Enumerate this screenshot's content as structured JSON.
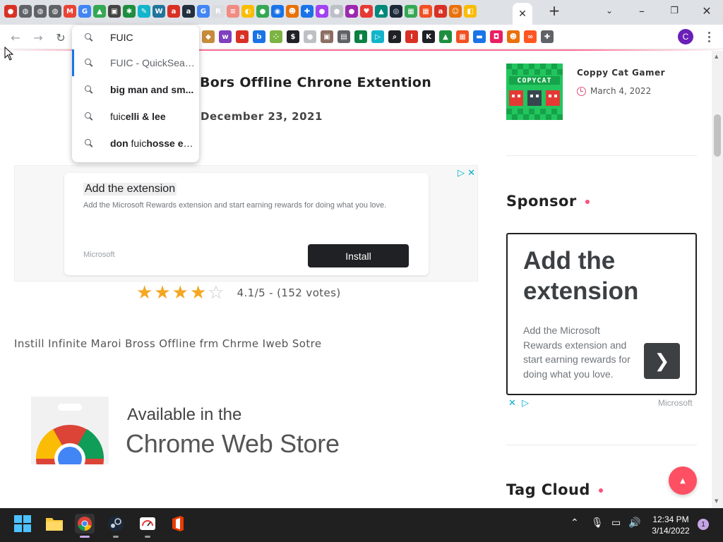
{
  "browser": {
    "tab_favicons": [
      {
        "name": "tab-favicon-red",
        "color": "#d93025",
        "glyph": "●"
      },
      {
        "name": "tab-favicon-globe",
        "color": "#5f6368",
        "glyph": "◍"
      },
      {
        "name": "tab-favicon-globe",
        "color": "#5f6368",
        "glyph": "◍"
      },
      {
        "name": "tab-favicon-globe",
        "color": "#5f6368",
        "glyph": "◍"
      },
      {
        "name": "tab-favicon-gmail",
        "color": "#ea4335",
        "glyph": "M"
      },
      {
        "name": "tab-favicon-google",
        "color": "#4285f4",
        "glyph": "G"
      },
      {
        "name": "tab-favicon-drive",
        "color": "#34a853",
        "glyph": "▲"
      },
      {
        "name": "tab-favicon-app",
        "color": "#444444",
        "glyph": "▣"
      },
      {
        "name": "tab-favicon-app",
        "color": "#1e8e3e",
        "glyph": "✱"
      },
      {
        "name": "tab-favicon-app",
        "color": "#12b5cb",
        "glyph": "✎"
      },
      {
        "name": "tab-favicon-wordpress",
        "color": "#21759b",
        "glyph": "W"
      },
      {
        "name": "tab-favicon-ask",
        "color": "#d93025",
        "glyph": "a"
      },
      {
        "name": "tab-favicon-amazon",
        "color": "#232f3e",
        "glyph": "a"
      },
      {
        "name": "tab-favicon-google",
        "color": "#4285f4",
        "glyph": "G"
      },
      {
        "name": "tab-favicon-app",
        "color": "#dadce0",
        "glyph": "R"
      },
      {
        "name": "tab-favicon-app",
        "color": "#f28b82",
        "glyph": "≡"
      },
      {
        "name": "tab-favicon-app",
        "color": "#fbbc04",
        "glyph": "◐"
      },
      {
        "name": "tab-favicon-app",
        "color": "#34a853",
        "glyph": "●"
      },
      {
        "name": "tab-favicon-app",
        "color": "#1a73e8",
        "glyph": "◉"
      },
      {
        "name": "tab-favicon-app",
        "color": "#e8710a",
        "glyph": "☻"
      },
      {
        "name": "tab-favicon-app",
        "color": "#1a73e8",
        "glyph": "✚"
      },
      {
        "name": "tab-favicon-app",
        "color": "#a142f4",
        "glyph": "●"
      },
      {
        "name": "tab-favicon-app",
        "color": "#bdc1c6",
        "glyph": "●"
      },
      {
        "name": "tab-favicon-app",
        "color": "#9c27b0",
        "glyph": "●"
      },
      {
        "name": "tab-favicon-app",
        "color": "#e53935",
        "glyph": "♥"
      },
      {
        "name": "tab-favicon-app",
        "color": "#00897b",
        "glyph": "▲"
      },
      {
        "name": "tab-favicon-steam",
        "color": "#1b2838",
        "glyph": "◎"
      },
      {
        "name": "tab-favicon-app",
        "color": "#34a853",
        "glyph": "▦"
      },
      {
        "name": "tab-favicon-microsoft",
        "color": "#f25022",
        "glyph": "▦"
      },
      {
        "name": "tab-favicon-ask",
        "color": "#d93025",
        "glyph": "a"
      },
      {
        "name": "tab-favicon-app",
        "color": "#e8710a",
        "glyph": "☺"
      },
      {
        "name": "tab-favicon-app",
        "color": "#fbbc04",
        "glyph": "◧"
      }
    ],
    "bookmark_icons": [
      {
        "name": "bookmark-icon",
        "color": "#c78b3b",
        "glyph": "◆"
      },
      {
        "name": "bookmark-icon",
        "color": "#7f3fbf",
        "glyph": "w"
      },
      {
        "name": "bookmark-icon",
        "color": "#d93025",
        "glyph": "a"
      },
      {
        "name": "bookmark-icon",
        "color": "#1a73e8",
        "glyph": "b"
      },
      {
        "name": "bookmark-icon",
        "color": "#7cb342",
        "glyph": "⁘"
      },
      {
        "name": "bookmark-icon",
        "color": "#202124",
        "glyph": "$"
      },
      {
        "name": "bookmark-icon",
        "color": "#bdc1c6",
        "glyph": "●"
      },
      {
        "name": "bookmark-icon",
        "color": "#8d6e63",
        "glyph": "▣"
      },
      {
        "name": "bookmark-icon",
        "color": "#5f6368",
        "glyph": "▤"
      },
      {
        "name": "bookmark-icon",
        "color": "#0b8043",
        "glyph": "▮"
      },
      {
        "name": "bookmark-icon",
        "color": "#12b5cb",
        "glyph": "▷"
      },
      {
        "name": "bookmark-icon",
        "color": "#202124",
        "glyph": "⌕"
      },
      {
        "name": "bookmark-icon",
        "color": "#d93025",
        "glyph": "!"
      },
      {
        "name": "bookmark-icon",
        "color": "#202124",
        "glyph": "K"
      },
      {
        "name": "bookmark-icon",
        "color": "#1e8e3e",
        "glyph": "▲"
      },
      {
        "name": "bookmark-icon",
        "color": "#f25022",
        "glyph": "▦"
      },
      {
        "name": "bookmark-icon",
        "color": "#1a73e8",
        "glyph": "▬"
      },
      {
        "name": "bookmark-icon",
        "color": "#e91e63",
        "glyph": "◘"
      },
      {
        "name": "bookmark-icon",
        "color": "#e8710a",
        "glyph": "☻"
      },
      {
        "name": "bookmark-icon",
        "color": "#ff5722",
        "glyph": "∞"
      },
      {
        "name": "extensions-icon",
        "color": "#5f6368",
        "glyph": "✚"
      }
    ],
    "profile_initial": "C"
  },
  "omnibox": {
    "query": "FUIC",
    "suggestions": [
      {
        "plain": "FUIC - QuickSear...",
        "bold": "",
        "rest": "",
        "selected": true
      },
      {
        "plain": "",
        "bold": "big man and sm...",
        "rest": "",
        "selected": false
      },
      {
        "plain": "fuic",
        "bold": "elli & lee",
        "rest": "",
        "selected": false
      },
      {
        "plain": "",
        "bold": "don ",
        "mid": "fuic",
        "rest": "hosse es...",
        "selected": false
      }
    ]
  },
  "post": {
    "title": "Bors Offline Chrone Extention",
    "date": "December 23, 2021",
    "rating_stars": 4.1,
    "rating_max": 5,
    "rating_text": "4.1/5 - (152 votes)",
    "install_text": "Instill Infinite Maroi Bross Offline frm Chrme Iweb Sotre",
    "cws_available": "Available in the",
    "cws_store": "Chrome Web Store"
  },
  "ad_banner": {
    "title": "Add the extension",
    "body": "Add the Microsoft Rewards extension and start earning rewards for doing what you love.",
    "brand": "Microsoft",
    "cta": "Install"
  },
  "sidebar": {
    "recent_post_title": "Coppy Cat Gamer",
    "recent_post_date": "March 4, 2022",
    "thumb_text": "COPYCAT",
    "sponsor_heading": "Sponsor",
    "ad_title": "Add the extension",
    "ad_body": "Add the Microsoft Rewards extension and start earning rewards for doing what you love.",
    "ad_brand": "Microsoft",
    "tag_cloud_heading": "Tag Cloud"
  },
  "taskbar": {
    "time": "12:34 PM",
    "date": "3/14/2022",
    "notification_count": "1"
  },
  "colors": {
    "accent": "#ff4f7b",
    "star": "#f5a623",
    "taskbar": "#202020"
  }
}
